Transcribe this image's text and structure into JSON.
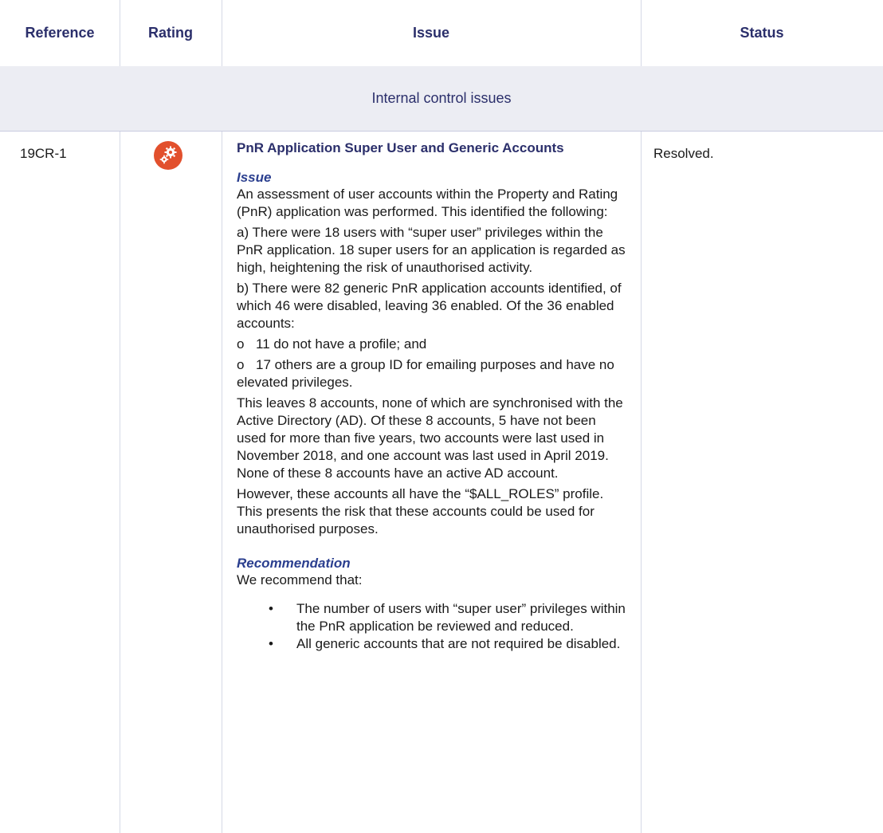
{
  "header": {
    "reference": "Reference",
    "rating": "Rating",
    "issue": "Issue",
    "status": "Status"
  },
  "section": {
    "label": "Internal control issues"
  },
  "row": {
    "reference": "19CR-1",
    "rating_icon": "gears-icon",
    "rating_color": "#e2502d",
    "title": "PnR Application Super User and Generic Accounts",
    "issue_heading": "Issue",
    "intro": "An assessment of user accounts within the Property and Rating (PnR) application was performed. This identified the following:",
    "point_a": "a)  There were 18 users with “super user” privileges within the PnR application. 18 super users for an application is regarded as high, heightening the risk of unauthorised activity.",
    "point_b": "b)  There were 82 generic PnR application accounts identified, of which 46 were disabled, leaving 36 enabled. Of the 36 enabled accounts:",
    "sub_marker": "o",
    "sub_1": "11 do not have a profile; and",
    "sub_2": "17 others are a group ID for emailing purposes and have no elevated privileges.",
    "para_leaves": "This leaves 8 accounts, none of which are synchronised with the Active Directory (AD). Of these 8 accounts, 5 have not been used for more than five years, two accounts were last used in November 2018, and one account was last used in April 2019. None of these 8 accounts have an active AD account.",
    "para_however": "However, these accounts all have the “$ALL_ROLES” profile. This presents the risk that these accounts could be used for unauthorised purposes.",
    "recommendation_heading": "Recommendation",
    "recommendation_intro": "We recommend that:",
    "bullet_char": "•",
    "recommendations": [
      "The number of users with “super user” privileges within the PnR application be reviewed and reduced.",
      "All generic accounts that are not required be disabled."
    ],
    "status": "Resolved."
  },
  "colors": {
    "heading": "#2b2f6b",
    "subheading": "#2b3f8f",
    "section_bg": "#ecedf3",
    "separator": "#d6d9e6"
  }
}
